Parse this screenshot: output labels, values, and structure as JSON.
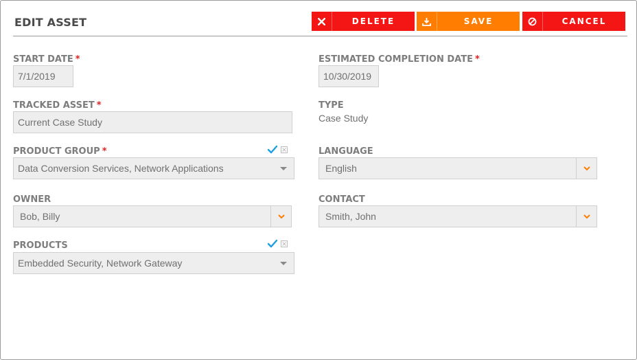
{
  "dialog": {
    "title": "EDIT ASSET"
  },
  "toolbar": {
    "delete_label": "DELETE",
    "save_label": "SAVE",
    "cancel_label": "CANCEL"
  },
  "form": {
    "required_marker": "*",
    "start_date": {
      "label": "START DATE",
      "value": "7/1/2019"
    },
    "estimated_completion_date": {
      "label": "ESTIMATED COMPLETION DATE",
      "value": "10/30/2019"
    },
    "tracked_asset": {
      "label": "TRACKED ASSET",
      "value": "Current Case Study"
    },
    "type": {
      "label": "TYPE",
      "value": "Case Study"
    },
    "product_group": {
      "label": "PRODUCT GROUP",
      "value": "Data Conversion Services, Network Applications"
    },
    "language": {
      "label": "LANGUAGE",
      "value": "English"
    },
    "owner": {
      "label": "OWNER",
      "value": "Bob, Billy"
    },
    "contact": {
      "label": "CONTACT",
      "value": "Smith, John"
    },
    "products": {
      "label": "PRODUCTS",
      "value": "Embedded Security, Network Gateway"
    }
  },
  "colors": {
    "delete": "#f41515",
    "save": "#ff7d00",
    "cancel": "#f41515",
    "required": "#e02020",
    "check": "#1a9fe0",
    "dropdown_caret": "#ff7d00"
  },
  "icons": {
    "delete": "close-icon",
    "save": "download-icon",
    "cancel": "ban-icon",
    "select_all": "check-icon",
    "clear": "clear-icon",
    "dropdown": "chevron-down-icon"
  }
}
